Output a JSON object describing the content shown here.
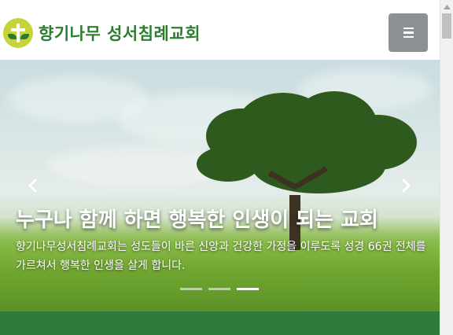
{
  "header": {
    "logo_text": "향기나무 성서침례교회",
    "menu_button_label": "Toggle navigation"
  },
  "hero": {
    "title": "누구나 함께 하면 행복한 인생이 되는 교회",
    "description": "향기나무성서침례교회는 성도들이 바른 신앙과 건강한 가정을 이루도록 성경 66권 전체를 가르쳐서 행복한 인생을 살게 합니다.",
    "prev_label": "Previous",
    "next_label": "Next",
    "slides_total": 3,
    "active_slide": 3
  },
  "colors": {
    "brand_green": "#2c7d30",
    "menu_button": "#8c9294",
    "band_green": "#2e7b3b"
  },
  "icons": {
    "logo": "cross-leaf-logo-icon",
    "menu": "hamburger-icon",
    "prev": "chevron-left-icon",
    "next": "chevron-right-icon",
    "scroll_up": "scroll-up-arrow-icon"
  }
}
